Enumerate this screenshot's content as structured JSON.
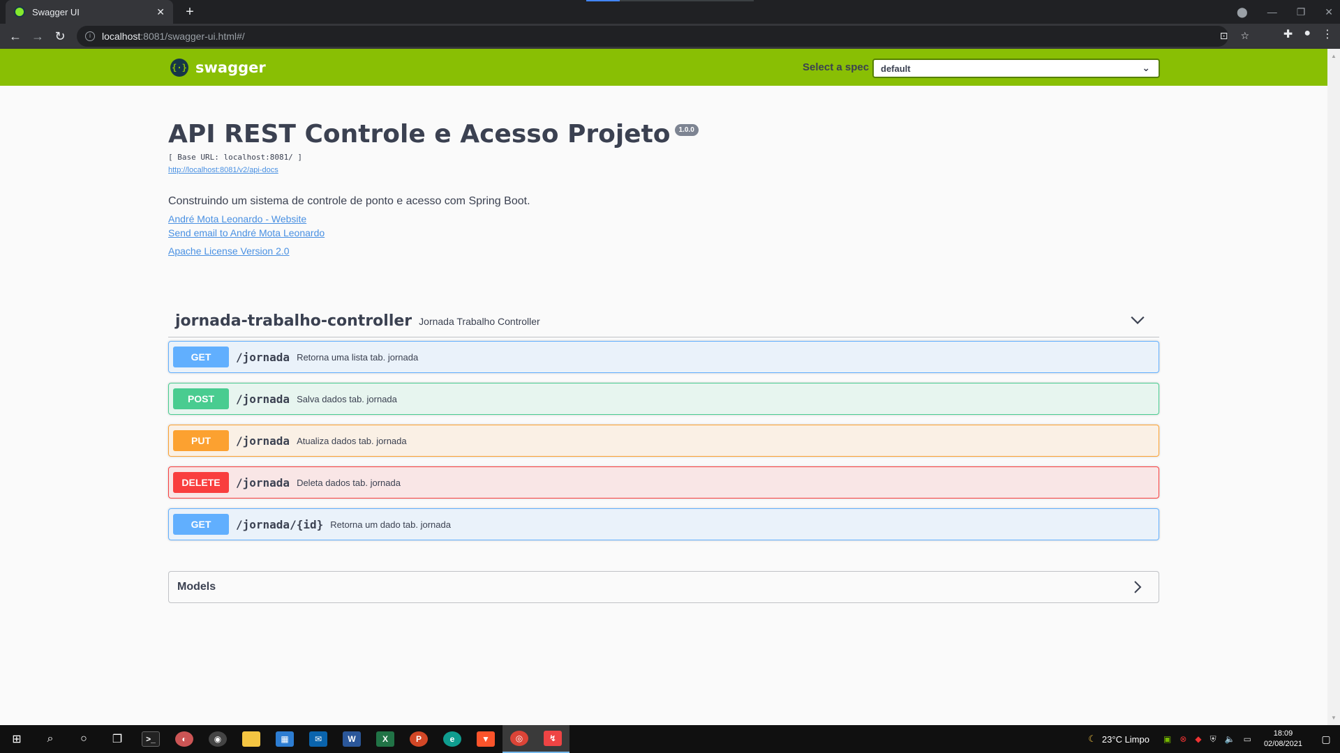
{
  "browser": {
    "tab_title": "Swagger UI",
    "new_tab": "+",
    "url_host": "localhost",
    "url_path": ":8081/swagger-ui.html#/"
  },
  "swagger": {
    "logo_text": "swagger",
    "select_label": "Select a spec",
    "select_value": "default"
  },
  "info": {
    "title": "API REST Controle e Acesso Projeto",
    "version": "1.0.0",
    "base_url": "[ Base URL: localhost:8081/ ]",
    "docs_link": "http://localhost:8081/v2/api-docs",
    "description": "Construindo um sistema de controle de ponto e acesso com Spring Boot.",
    "website_link": "André Mota Leonardo - Website",
    "email_link": "Send email to André Mota Leonardo",
    "license_link": "Apache License Version 2.0"
  },
  "tag": {
    "name": "jornada-trabalho-controller",
    "description": "Jornada Trabalho Controller"
  },
  "operations": [
    {
      "method": "GET",
      "path": "/jornada",
      "summary": "Retorna uma lista tab. jornada"
    },
    {
      "method": "POST",
      "path": "/jornada",
      "summary": "Salva dados tab. jornada"
    },
    {
      "method": "PUT",
      "path": "/jornada",
      "summary": "Atualiza dados tab. jornada"
    },
    {
      "method": "DELETE",
      "path": "/jornada",
      "summary": "Deleta dados tab. jornada"
    },
    {
      "method": "GET",
      "path": "/jornada/{id}",
      "summary": "Retorna um dado tab. jornada"
    }
  ],
  "models": {
    "title": "Models"
  },
  "taskbar": {
    "weather": "23°C  Limpo",
    "time": "18:09",
    "date": "02/08/2021"
  },
  "colors": {
    "topbar": "#89bf04",
    "get": "#61affe",
    "post": "#49cc90",
    "put": "#fca130",
    "delete": "#f93e3e"
  }
}
